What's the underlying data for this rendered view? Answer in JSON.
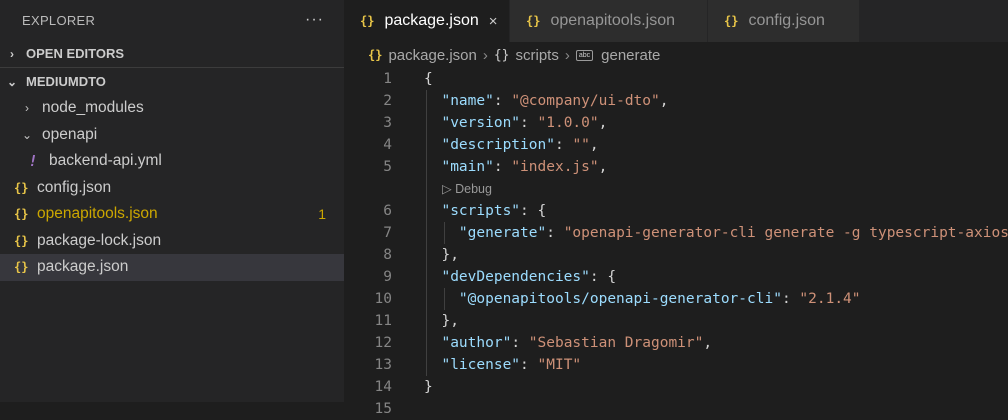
{
  "sidebar": {
    "title": "EXPLORER",
    "more": "···",
    "open_editors": "OPEN EDITORS",
    "project": "MEDIUMDTO",
    "items": [
      {
        "label": "node_modules",
        "chevron": "›"
      },
      {
        "label": "openapi",
        "chevron": "⌄"
      },
      {
        "label": "backend-api.yml",
        "icon": "!"
      },
      {
        "label": "config.json",
        "icon": "{}"
      },
      {
        "label": "openapitools.json",
        "icon": "{}",
        "badge": "1"
      },
      {
        "label": "package-lock.json",
        "icon": "{}"
      },
      {
        "label": "package.json",
        "icon": "{}"
      }
    ]
  },
  "tabs": [
    {
      "label": "package.json",
      "icon": "{}",
      "close": "×"
    },
    {
      "label": "openapitools.json",
      "icon": "{}"
    },
    {
      "label": "config.json",
      "icon": "{}"
    }
  ],
  "breadcrumb": {
    "file": "package.json",
    "scripts": "scripts",
    "generate": "generate",
    "abc": "abc"
  },
  "codelens": "▷ Debug",
  "code_lines": [
    {
      "n": "1",
      "t": [
        [
          "p",
          "{"
        ]
      ]
    },
    {
      "n": "2",
      "t": [
        [
          "p",
          "  "
        ],
        [
          "k",
          "\"name\""
        ],
        [
          "p",
          ": "
        ],
        [
          "s",
          "\"@company/ui-dto\""
        ],
        [
          "p",
          ","
        ]
      ]
    },
    {
      "n": "3",
      "t": [
        [
          "p",
          "  "
        ],
        [
          "k",
          "\"version\""
        ],
        [
          "p",
          ": "
        ],
        [
          "s",
          "\"1.0.0\""
        ],
        [
          "p",
          ","
        ]
      ]
    },
    {
      "n": "4",
      "t": [
        [
          "p",
          "  "
        ],
        [
          "k",
          "\"description\""
        ],
        [
          "p",
          ": "
        ],
        [
          "s",
          "\"\""
        ],
        [
          "p",
          ","
        ]
      ]
    },
    {
      "n": "5",
      "t": [
        [
          "p",
          "  "
        ],
        [
          "k",
          "\"main\""
        ],
        [
          "p",
          ": "
        ],
        [
          "s",
          "\"index.js\""
        ],
        [
          "p",
          ","
        ]
      ]
    },
    {
      "n": "6",
      "t": [
        [
          "p",
          "  "
        ],
        [
          "k",
          "\"scripts\""
        ],
        [
          "p",
          ": {"
        ]
      ]
    },
    {
      "n": "7",
      "t": [
        [
          "p",
          "    "
        ],
        [
          "k",
          "\"generate\""
        ],
        [
          "p",
          ": "
        ],
        [
          "s",
          "\"openapi-generator-cli generate -g typescript-axios"
        ]
      ]
    },
    {
      "n": "8",
      "t": [
        [
          "p",
          "  },"
        ]
      ]
    },
    {
      "n": "9",
      "t": [
        [
          "p",
          "  "
        ],
        [
          "k",
          "\"devDependencies\""
        ],
        [
          "p",
          ": {"
        ]
      ]
    },
    {
      "n": "10",
      "t": [
        [
          "p",
          "    "
        ],
        [
          "k",
          "\"@openapitools/openapi-generator-cli\""
        ],
        [
          "p",
          ": "
        ],
        [
          "s",
          "\"2.1.4\""
        ]
      ]
    },
    {
      "n": "11",
      "t": [
        [
          "p",
          "  },"
        ]
      ]
    },
    {
      "n": "12",
      "t": [
        [
          "p",
          "  "
        ],
        [
          "k",
          "\"author\""
        ],
        [
          "p",
          ": "
        ],
        [
          "s",
          "\"Sebastian Dragomir\""
        ],
        [
          "p",
          ","
        ]
      ]
    },
    {
      "n": "13",
      "t": [
        [
          "p",
          "  "
        ],
        [
          "k",
          "\"license\""
        ],
        [
          "p",
          ": "
        ],
        [
          "s",
          "\"MIT\""
        ]
      ]
    },
    {
      "n": "14",
      "t": [
        [
          "p",
          "}"
        ]
      ]
    },
    {
      "n": "15",
      "t": []
    }
  ]
}
